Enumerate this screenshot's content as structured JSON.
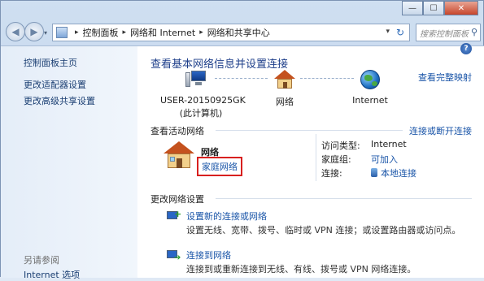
{
  "window": {
    "caption": {
      "minimize_label": "—",
      "maximize_label": "☐",
      "close_label": "✕"
    }
  },
  "nav": {
    "back_label": "◀",
    "forward_label": "▶",
    "breadcrumb": [
      "控制面板",
      "网络和 Internet",
      "网络和共享中心"
    ],
    "breadcrumb_sep": "▸",
    "refresh_label": "↻",
    "search_placeholder": "搜索控制面板"
  },
  "sidebar": {
    "items": [
      "控制面板主页",
      "更改适配器设置",
      "更改高级共享设置"
    ],
    "see_also_heading": "另请参阅",
    "see_also_items": [
      "Internet 选项"
    ]
  },
  "main": {
    "title": "查看基本网络信息并设置连接",
    "full_map_link": "查看完整映射",
    "map": {
      "computer_name": "USER-20150925GK",
      "computer_sub": "(此计算机)",
      "network": "网络",
      "internet": "Internet"
    },
    "active_heading": "查看活动网络",
    "connect_link": "连接或断开连接",
    "active_network": {
      "name": "网络",
      "type": "家庭网络",
      "access_type_label": "访问类型:",
      "access_type_value": "Internet",
      "homegroup_label": "家庭组:",
      "homegroup_value": "可加入",
      "connection_label": "连接:",
      "connection_value": "本地连接"
    },
    "change_heading": "更改网络设置",
    "tasks": [
      {
        "link": "设置新的连接或网络",
        "desc": "设置无线、宽带、拨号、临时或 VPN 连接；或设置路由器或访问点。"
      },
      {
        "link": "连接到网络",
        "desc": "连接到或重新连接到无线、有线、拨号或 VPN 网络连接。"
      }
    ]
  },
  "colors": {
    "link": "#1a55a8",
    "title": "#1e3f8a",
    "highlight_box": "#d8201f"
  }
}
